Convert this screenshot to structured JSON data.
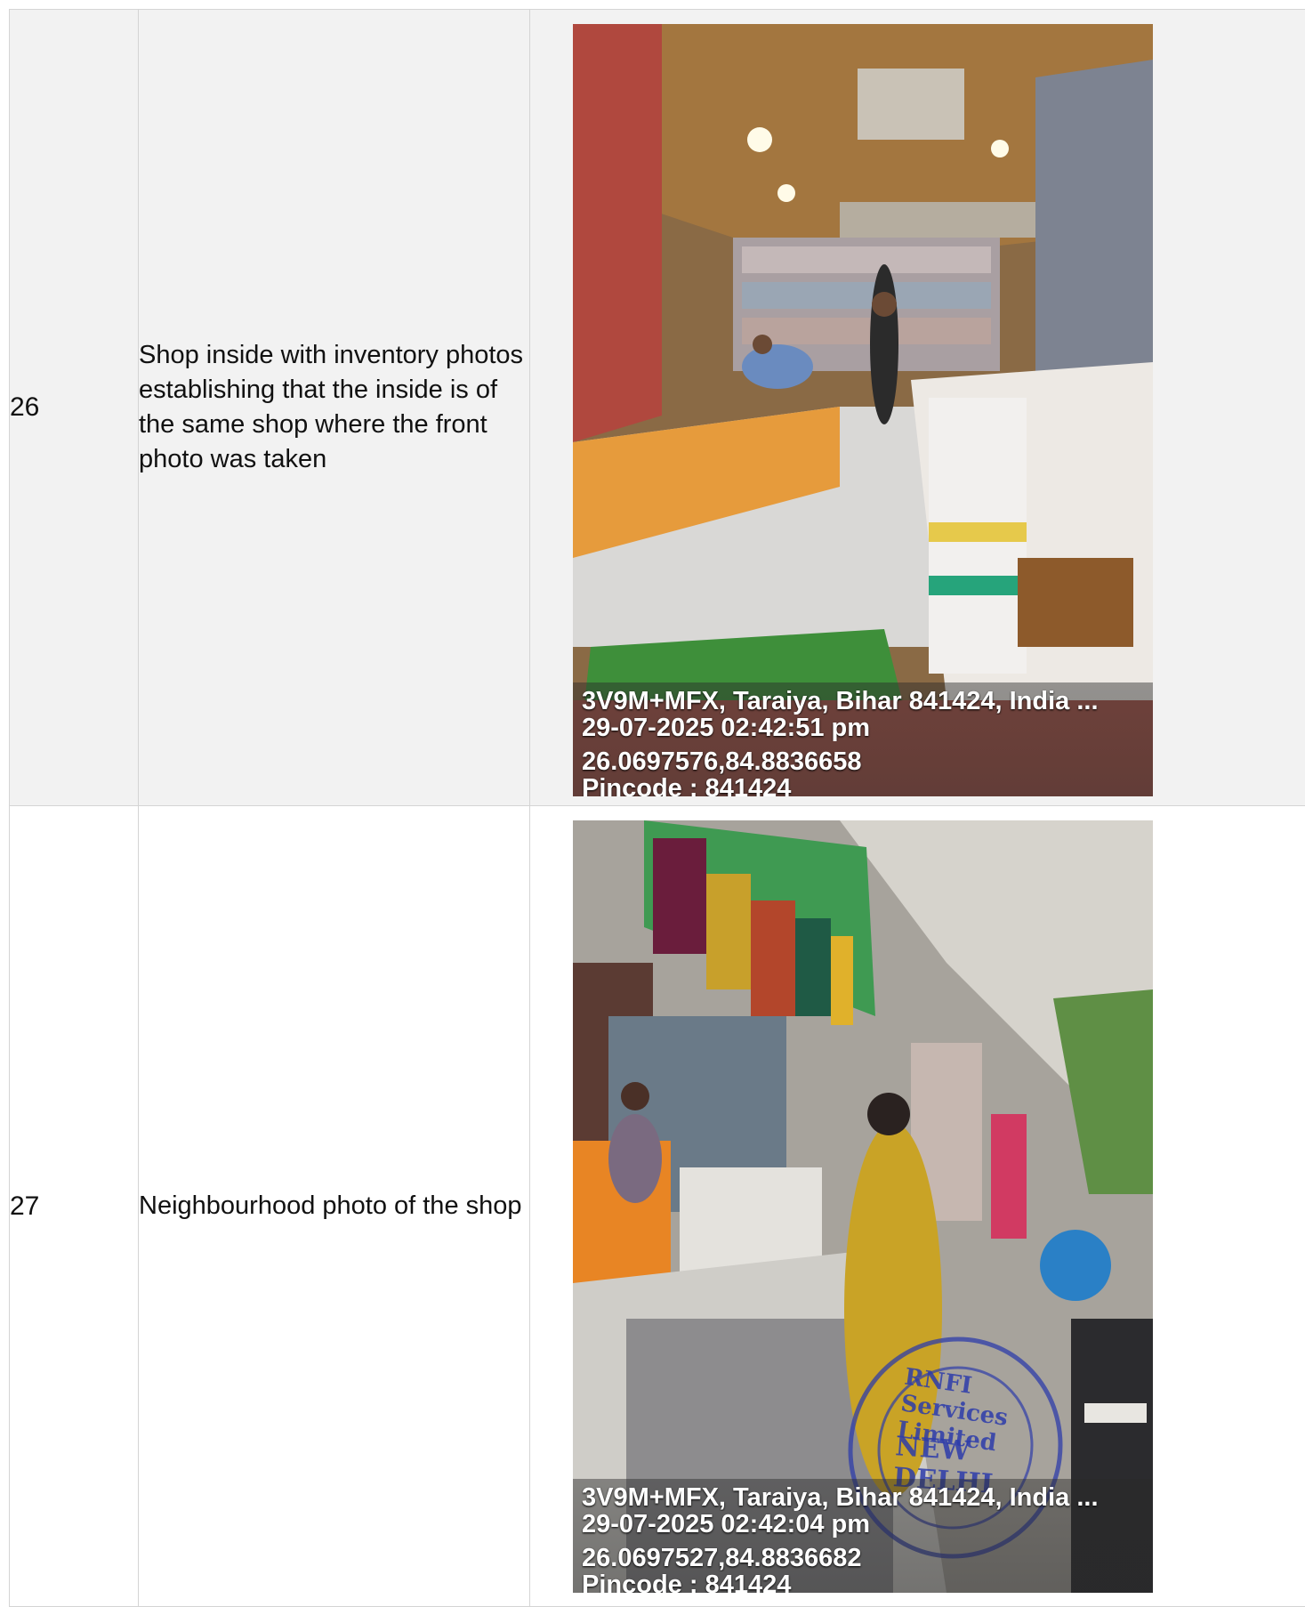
{
  "rows": [
    {
      "number": "26",
      "description": "Shop inside with inventory photos establishing that the inside is of the same shop where the front photo was taken",
      "photo": {
        "address": "3V9M+MFX, Taraiya, Bihar 841424, India ...",
        "datetime": "29-07-2025 02:42:51 pm",
        "coordinates": "26.0697576,84.8836658",
        "pincode": "Pincode : 841424"
      }
    },
    {
      "number": "27",
      "description": "Neighbourhood photo of the shop",
      "photo": {
        "address": "3V9M+MFX, Taraiya, Bihar 841424, India ...",
        "datetime": "29-07-2025 02:42:04 pm",
        "coordinates": "26.0697527,84.8836682",
        "pincode": "Pincode : 841424",
        "stamp_text_top": "RNFI Services Limited",
        "stamp_text_middle": "NEW DELHI"
      }
    }
  ]
}
